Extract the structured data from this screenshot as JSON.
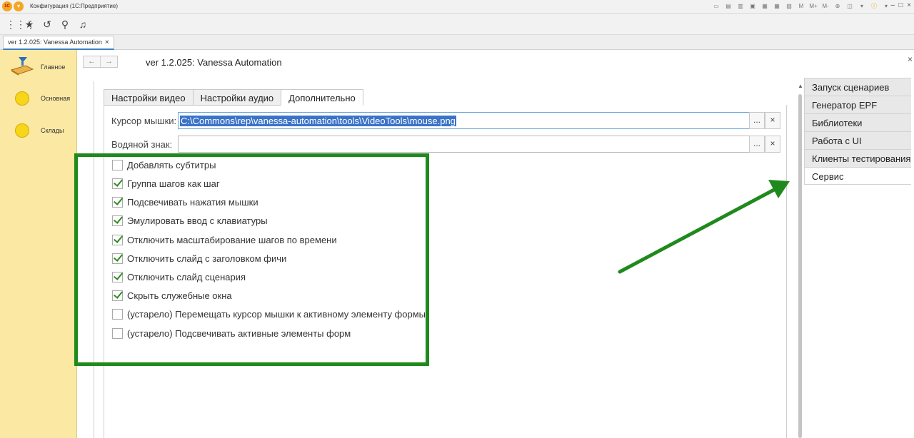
{
  "app": {
    "logo_text": "1С",
    "window_title": "Конфигурация  (1С:Предприятие)",
    "title_tools": [
      "M",
      "M+",
      "M-"
    ]
  },
  "open_tab": {
    "label": "ver 1.2.025: Vanessa Automation",
    "close": "×"
  },
  "sidebar": {
    "items": [
      {
        "label": "Главное",
        "icon": "home-desk-icon"
      },
      {
        "label": "Основная",
        "icon": "yellow-circle-icon"
      },
      {
        "label": "Склады",
        "icon": "yellow-circle-icon"
      }
    ]
  },
  "page": {
    "title": "ver 1.2.025: Vanessa Automation",
    "close": "×"
  },
  "form_tabs": [
    "Настройки видео",
    "Настройки аудио",
    "Дополнительно"
  ],
  "active_tab": "Дополнительно",
  "fields": {
    "cursor_label": "Курсор мышки:",
    "cursor_value": "C:\\Commons\\rep\\vanessa-automation\\tools\\VideoTools\\mouse.png",
    "watermark_label": "Водяной знак:",
    "watermark_value": "",
    "select_btn": "...",
    "clear_btn": "×"
  },
  "checkboxes": [
    {
      "label": "Добавлять субтитры",
      "checked": false
    },
    {
      "label": "Группа шагов как шаг",
      "checked": true
    },
    {
      "label": "Подсвечивать нажатия мышки",
      "checked": true
    },
    {
      "label": "Эмулировать ввод с клавиатуры",
      "checked": true
    },
    {
      "label": "Отключить масштабирование шагов по времени",
      "checked": true
    },
    {
      "label": "Отключить слайд с заголовком фичи",
      "checked": true
    },
    {
      "label": "Отключить слайд сценария",
      "checked": true
    },
    {
      "label": "Скрыть служебные окна",
      "checked": true
    },
    {
      "label": "(устарело) Перемещать курсор мышки к активному элементу формы",
      "checked": false
    },
    {
      "label": "(устарело) Подсвечивать активные элементы форм",
      "checked": false
    }
  ],
  "right_nav": [
    "Запуск сценариев",
    "Генератор EPF",
    "Библиотеки",
    "Работа с UI",
    "Клиенты тестирования",
    "Сервис"
  ],
  "right_nav_active": "Сервис",
  "colors": {
    "highlight": "#1f8a1c",
    "sidebar_bg": "#fbe9a3",
    "selection": "#3b73c8"
  }
}
